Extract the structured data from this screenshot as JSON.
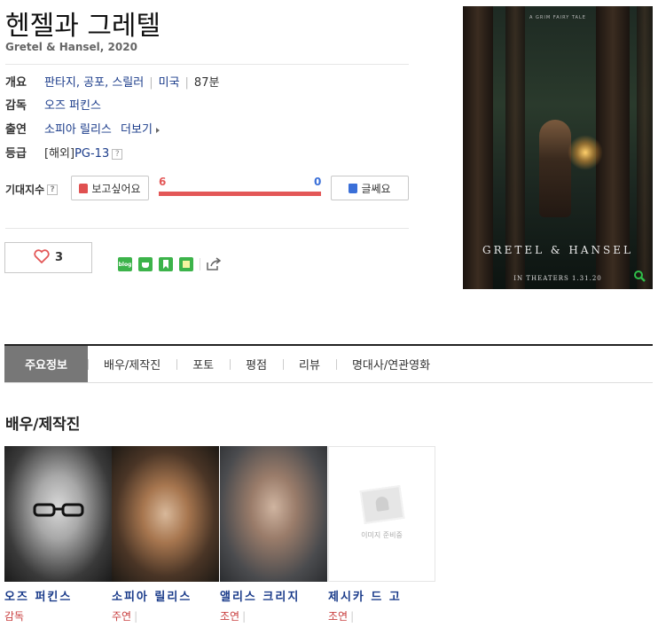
{
  "movie": {
    "title": "헨젤과 그레텔",
    "original_title": "Gretel & Hansel, 2020"
  },
  "info": {
    "overview_label": "개요",
    "genres": "판타지, 공포, 스릴러",
    "country": "미국",
    "runtime": "87분",
    "director_label": "감독",
    "director": "오즈 퍼킨스",
    "cast_label": "출연",
    "cast": "소피아 릴리스",
    "more_label": "더보기",
    "rating_label": "등급",
    "rating_prefix": "[해외]",
    "rating": "PG-13",
    "help_glyph": "?"
  },
  "expectation": {
    "label": "기대지수",
    "want_label": "보고싶어요",
    "meh_label": "글쎄요",
    "want_count": "6",
    "meh_count": "0",
    "want_color": "#e35757",
    "meh_color": "#3a6fd8"
  },
  "like": {
    "count": "3",
    "icon": "heart-icon"
  },
  "share": {
    "icons": [
      "blog-icon",
      "cafe-icon",
      "bookmark-icon",
      "memo-icon",
      "share-icon"
    ],
    "blog_text": "blog"
  },
  "poster": {
    "tagline": "A GRIM FAIRY TALE",
    "title": "GRETEL & HANSEL",
    "date": "IN THEATERS 1.31.20"
  },
  "tabs": [
    {
      "label": "주요정보",
      "active": true
    },
    {
      "label": "배우/제작진",
      "active": false
    },
    {
      "label": "포토",
      "active": false
    },
    {
      "label": "평점",
      "active": false
    },
    {
      "label": "리뷰",
      "active": false
    },
    {
      "label": "명대사/연관영화",
      "active": false
    }
  ],
  "cast_section": {
    "title": "배우/제작진",
    "no_image_text": "이미지 준비중",
    "people": [
      {
        "name": "오즈 퍼킨스",
        "role": "감독",
        "show_bar": false
      },
      {
        "name": "소피아 릴리스",
        "role": "주연",
        "show_bar": true
      },
      {
        "name": "앨리스 크리지",
        "role": "조연",
        "show_bar": true
      },
      {
        "name": "제시카 드 고",
        "role": "조연",
        "show_bar": true
      }
    ],
    "bar_glyph": "|"
  }
}
